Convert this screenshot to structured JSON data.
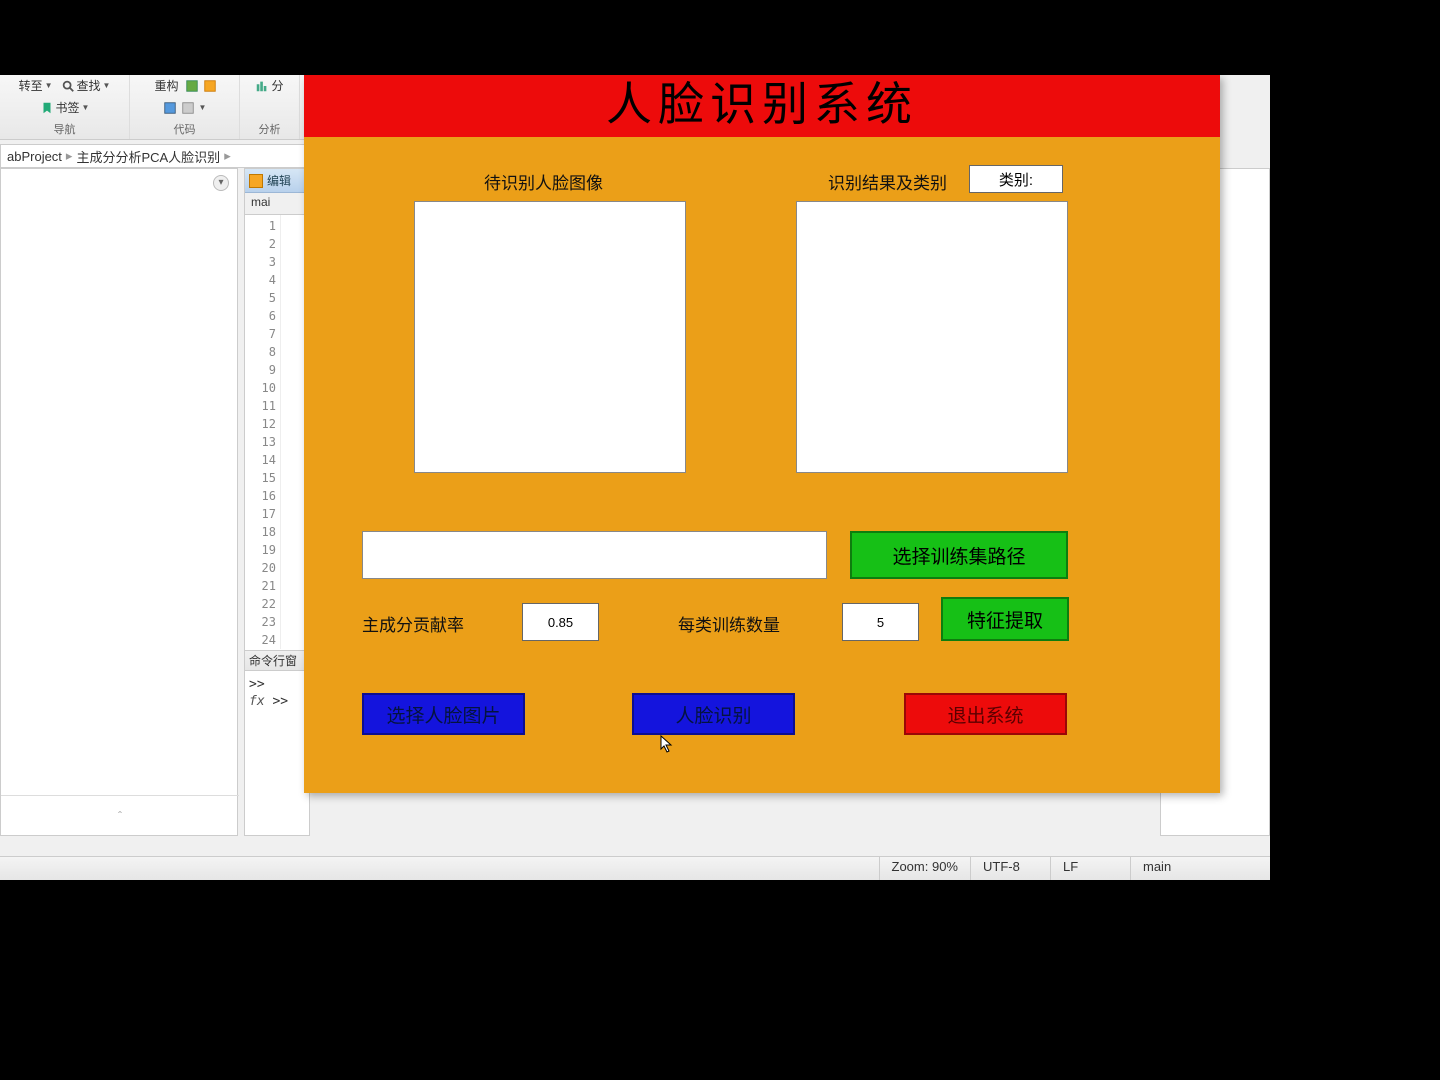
{
  "toolstrip": {
    "group1_btn": "转至",
    "find": "查找",
    "bookmark": "书签",
    "group1_label": "导航",
    "group2_btn": "重构",
    "group2_label": "代码",
    "group3_btn": "分析",
    "group3_trunc": "分"
  },
  "breadcrumb": {
    "seg1": "abProject",
    "seg2": "主成分分析PCA人脸识别"
  },
  "left": {
    "chevron": "▾",
    "expand": "ˆ"
  },
  "editor": {
    "title": "编辑",
    "tab": "mai",
    "lines": [
      "1",
      "2",
      "3",
      "4",
      "5",
      "6",
      "7",
      "8",
      "9",
      "10",
      "11",
      "12",
      "13",
      "14",
      "15",
      "16",
      "17",
      "18",
      "19",
      "20",
      "21",
      "22",
      "23",
      "24"
    ]
  },
  "cmdwin": {
    "title": "命令行窗",
    "p1": ">>",
    "p2": ">>",
    "fx": "fx"
  },
  "status": {
    "zoom": "Zoom: 90%",
    "enc": "UTF-8",
    "eol": "LF",
    "func": "main"
  },
  "gui": {
    "title": "人脸识别系统",
    "left_label": "待识别人脸图像",
    "right_label": "识别结果及类别",
    "class_box": "类别:",
    "path_value": "",
    "select_path_btn": "选择训练集路径",
    "pca_label": "主成分贡献率",
    "pca_value": "0.85",
    "perclass_label": "每类训练数量",
    "perclass_value": "5",
    "feature_btn": "特征提取",
    "select_img_btn": "选择人脸图片",
    "recognize_btn": "人脸识别",
    "exit_btn": "退出系统"
  }
}
